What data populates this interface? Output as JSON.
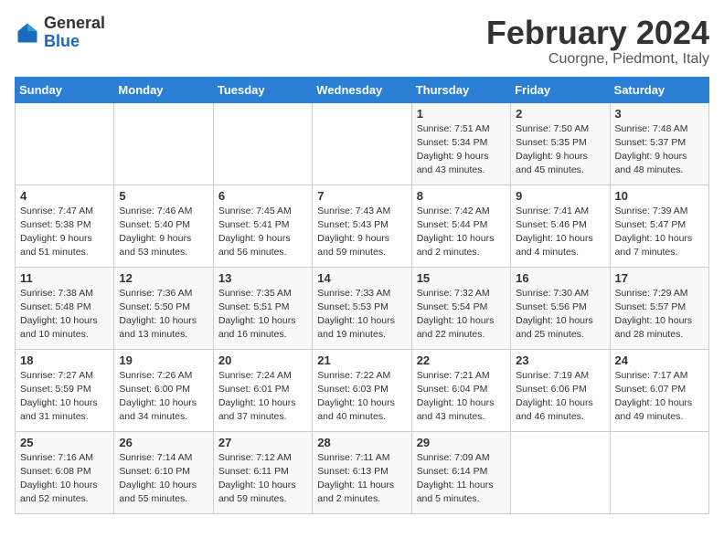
{
  "logo": {
    "general": "General",
    "blue": "Blue"
  },
  "title": "February 2024",
  "location": "Cuorgne, Piedmont, Italy",
  "days_of_week": [
    "Sunday",
    "Monday",
    "Tuesday",
    "Wednesday",
    "Thursday",
    "Friday",
    "Saturday"
  ],
  "weeks": [
    [
      {
        "day": "",
        "info": ""
      },
      {
        "day": "",
        "info": ""
      },
      {
        "day": "",
        "info": ""
      },
      {
        "day": "",
        "info": ""
      },
      {
        "day": "1",
        "info": "Sunrise: 7:51 AM\nSunset: 5:34 PM\nDaylight: 9 hours\nand 43 minutes."
      },
      {
        "day": "2",
        "info": "Sunrise: 7:50 AM\nSunset: 5:35 PM\nDaylight: 9 hours\nand 45 minutes."
      },
      {
        "day": "3",
        "info": "Sunrise: 7:48 AM\nSunset: 5:37 PM\nDaylight: 9 hours\nand 48 minutes."
      }
    ],
    [
      {
        "day": "4",
        "info": "Sunrise: 7:47 AM\nSunset: 5:38 PM\nDaylight: 9 hours\nand 51 minutes."
      },
      {
        "day": "5",
        "info": "Sunrise: 7:46 AM\nSunset: 5:40 PM\nDaylight: 9 hours\nand 53 minutes."
      },
      {
        "day": "6",
        "info": "Sunrise: 7:45 AM\nSunset: 5:41 PM\nDaylight: 9 hours\nand 56 minutes."
      },
      {
        "day": "7",
        "info": "Sunrise: 7:43 AM\nSunset: 5:43 PM\nDaylight: 9 hours\nand 59 minutes."
      },
      {
        "day": "8",
        "info": "Sunrise: 7:42 AM\nSunset: 5:44 PM\nDaylight: 10 hours\nand 2 minutes."
      },
      {
        "day": "9",
        "info": "Sunrise: 7:41 AM\nSunset: 5:46 PM\nDaylight: 10 hours\nand 4 minutes."
      },
      {
        "day": "10",
        "info": "Sunrise: 7:39 AM\nSunset: 5:47 PM\nDaylight: 10 hours\nand 7 minutes."
      }
    ],
    [
      {
        "day": "11",
        "info": "Sunrise: 7:38 AM\nSunset: 5:48 PM\nDaylight: 10 hours\nand 10 minutes."
      },
      {
        "day": "12",
        "info": "Sunrise: 7:36 AM\nSunset: 5:50 PM\nDaylight: 10 hours\nand 13 minutes."
      },
      {
        "day": "13",
        "info": "Sunrise: 7:35 AM\nSunset: 5:51 PM\nDaylight: 10 hours\nand 16 minutes."
      },
      {
        "day": "14",
        "info": "Sunrise: 7:33 AM\nSunset: 5:53 PM\nDaylight: 10 hours\nand 19 minutes."
      },
      {
        "day": "15",
        "info": "Sunrise: 7:32 AM\nSunset: 5:54 PM\nDaylight: 10 hours\nand 22 minutes."
      },
      {
        "day": "16",
        "info": "Sunrise: 7:30 AM\nSunset: 5:56 PM\nDaylight: 10 hours\nand 25 minutes."
      },
      {
        "day": "17",
        "info": "Sunrise: 7:29 AM\nSunset: 5:57 PM\nDaylight: 10 hours\nand 28 minutes."
      }
    ],
    [
      {
        "day": "18",
        "info": "Sunrise: 7:27 AM\nSunset: 5:59 PM\nDaylight: 10 hours\nand 31 minutes."
      },
      {
        "day": "19",
        "info": "Sunrise: 7:26 AM\nSunset: 6:00 PM\nDaylight: 10 hours\nand 34 minutes."
      },
      {
        "day": "20",
        "info": "Sunrise: 7:24 AM\nSunset: 6:01 PM\nDaylight: 10 hours\nand 37 minutes."
      },
      {
        "day": "21",
        "info": "Sunrise: 7:22 AM\nSunset: 6:03 PM\nDaylight: 10 hours\nand 40 minutes."
      },
      {
        "day": "22",
        "info": "Sunrise: 7:21 AM\nSunset: 6:04 PM\nDaylight: 10 hours\nand 43 minutes."
      },
      {
        "day": "23",
        "info": "Sunrise: 7:19 AM\nSunset: 6:06 PM\nDaylight: 10 hours\nand 46 minutes."
      },
      {
        "day": "24",
        "info": "Sunrise: 7:17 AM\nSunset: 6:07 PM\nDaylight: 10 hours\nand 49 minutes."
      }
    ],
    [
      {
        "day": "25",
        "info": "Sunrise: 7:16 AM\nSunset: 6:08 PM\nDaylight: 10 hours\nand 52 minutes."
      },
      {
        "day": "26",
        "info": "Sunrise: 7:14 AM\nSunset: 6:10 PM\nDaylight: 10 hours\nand 55 minutes."
      },
      {
        "day": "27",
        "info": "Sunrise: 7:12 AM\nSunset: 6:11 PM\nDaylight: 10 hours\nand 59 minutes."
      },
      {
        "day": "28",
        "info": "Sunrise: 7:11 AM\nSunset: 6:13 PM\nDaylight: 11 hours\nand 2 minutes."
      },
      {
        "day": "29",
        "info": "Sunrise: 7:09 AM\nSunset: 6:14 PM\nDaylight: 11 hours\nand 5 minutes."
      },
      {
        "day": "",
        "info": ""
      },
      {
        "day": "",
        "info": ""
      }
    ]
  ]
}
